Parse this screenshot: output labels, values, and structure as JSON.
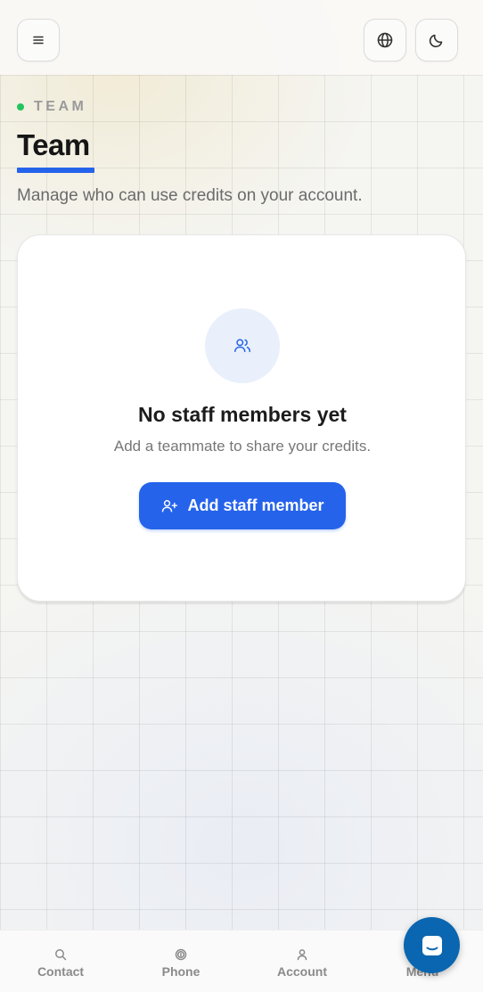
{
  "header": {
    "menu_icon": "hamburger-icon",
    "language_icon": "globe-icon",
    "theme_icon": "moon-icon"
  },
  "hero": {
    "eyebrow": "TEAM",
    "title": "Team",
    "subtitle": "Manage who can use credits on your account."
  },
  "empty_state": {
    "icon": "users-icon",
    "title": "No staff members yet",
    "description": "Add a teammate to share your credits.",
    "button_label": "Add staff member",
    "button_icon": "user-plus-icon"
  },
  "bottom_nav": {
    "items": [
      {
        "label": "Contact",
        "icon": "search-icon"
      },
      {
        "label": "Phone",
        "icon": "fingerprint-icon"
      },
      {
        "label": "Account",
        "icon": "user-icon"
      },
      {
        "label": "Menu",
        "icon": "menu-icon"
      }
    ]
  },
  "chat": {
    "icon": "chat-bubble-icon"
  },
  "colors": {
    "accent": "#2563eb",
    "status_dot": "#22c55e",
    "chat_fab": "#0a66b0"
  }
}
